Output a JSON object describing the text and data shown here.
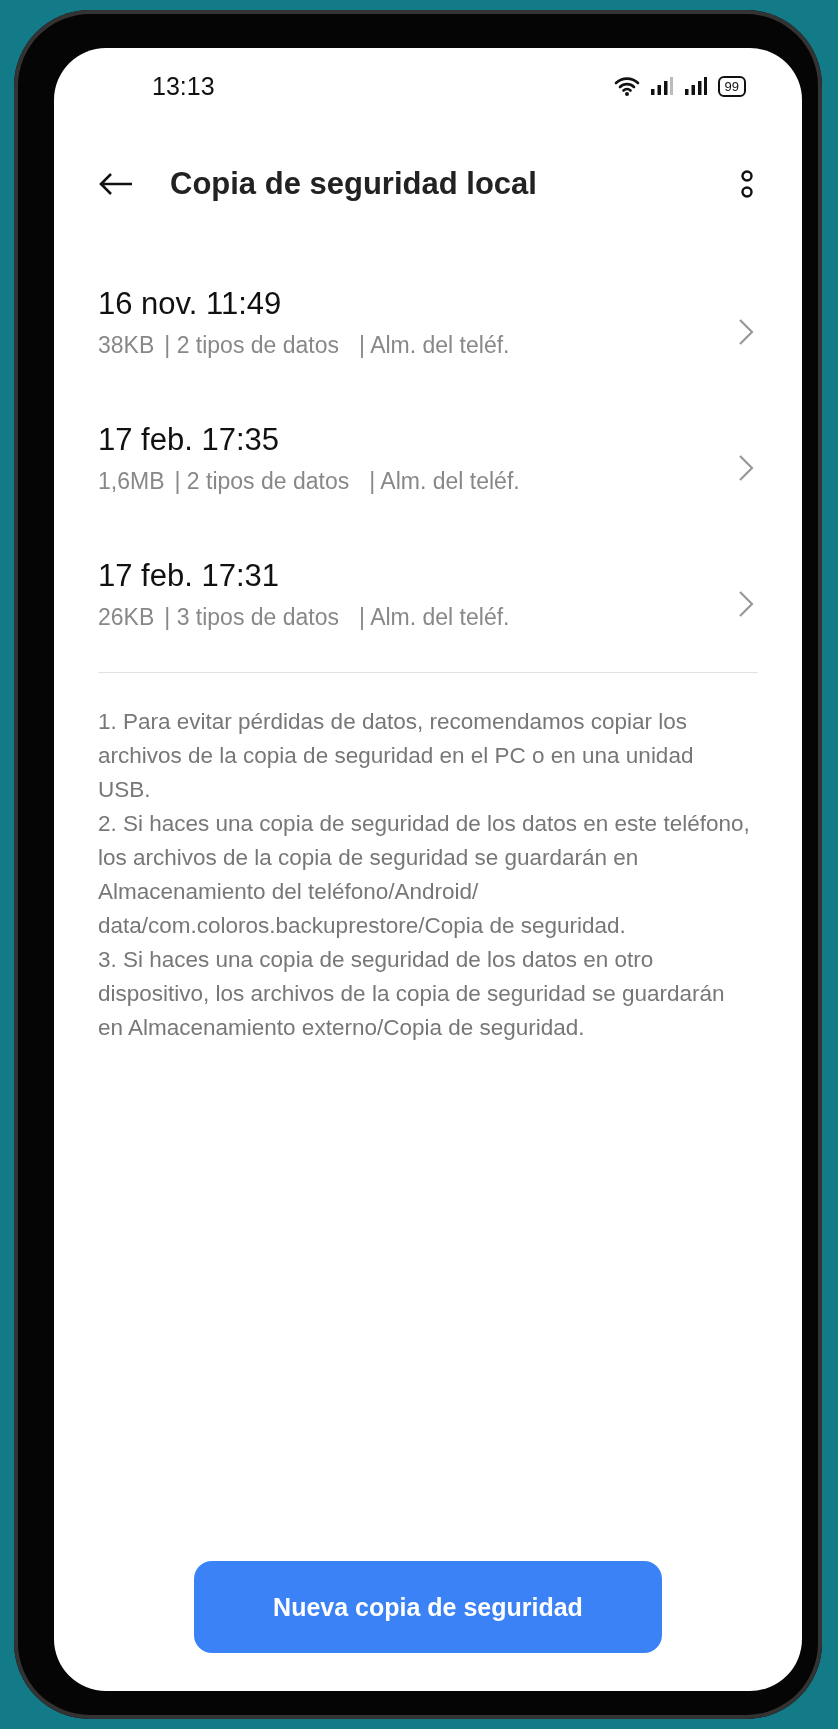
{
  "status_bar": {
    "time": "13:13",
    "battery": "99"
  },
  "header": {
    "title": "Copia de seguridad local"
  },
  "backups": [
    {
      "date": "16 nov. 11:49",
      "size": "38KB",
      "types": "| 2 tipos de datos",
      "location": "| Alm. del teléf."
    },
    {
      "date": "17 feb. 17:35",
      "size": "1,6MB",
      "types": "| 2 tipos de datos",
      "location": "| Alm. del teléf."
    },
    {
      "date": "17 feb. 17:31",
      "size": "26KB",
      "types": "| 3 tipos de datos",
      "location": "| Alm. del teléf."
    }
  ],
  "notes": [
    "1. Para evitar pérdidas de datos, recomendamos copiar los archivos de la copia de seguridad en el PC o en una unidad USB.",
    "2. Si haces una copia de seguridad de los datos en este teléfono, los archivos de la copia de seguridad se guardarán en Almacenamiento del teléfono/Android/ data/com.coloros.backuprestore/Copia de seguridad.",
    "3. Si haces una copia de seguridad de los datos en otro dispositivo, los archivos de la copia de seguridad se guardarán en Almacenamiento externo/Copia de seguridad."
  ],
  "button": "Nueva copia de seguridad"
}
